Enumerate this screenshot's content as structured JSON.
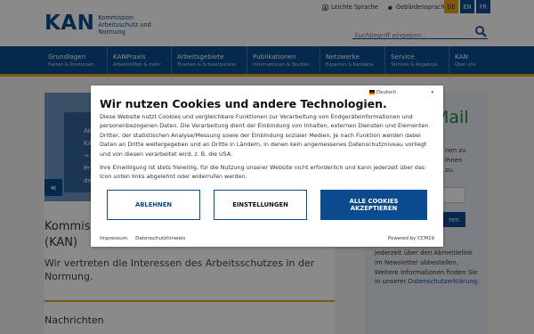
{
  "logo": {
    "mark": "KAN",
    "sub_lines": [
      "Kommission",
      "Arbeitsschutz und",
      "Normung"
    ]
  },
  "toplinks": {
    "easy_language": "Leichte Sprache",
    "sign_language": "Gebärdensprache"
  },
  "languages": [
    {
      "code": "DE",
      "active": true
    },
    {
      "code": "EN",
      "active": false
    },
    {
      "code": "FR",
      "active": false
    }
  ],
  "search": {
    "placeholder": "Suchbegriff eingeben..."
  },
  "nav": [
    {
      "title": "Grundlagen",
      "sub": "Fakten & Positionen"
    },
    {
      "title": "KANPraxis",
      "sub": "Arbeitshilfen & mehr"
    },
    {
      "title": "Arbeitsgebiete",
      "sub": "Themen & Schwerpunkte"
    },
    {
      "title": "Publikationen",
      "sub": "Informationen & Studien"
    },
    {
      "title": "Netzwerke",
      "sub": "Experten & Kontakte"
    },
    {
      "title": "Service",
      "sub": "Termine & Angebote"
    },
    {
      "title": "KAN",
      "sub": "Über uns"
    }
  ],
  "hero": {
    "text_lines": [
      "Ak",
      "KA",
      "→",
      "Pr",
      "de"
    ],
    "prev_arrow": "«"
  },
  "main": {
    "title_line1": "Kommis",
    "title_line2": "(KAN)",
    "subtitle": "Wir vertreten die Interessen des Arbeitsschutzes in der Normung.",
    "news_heading": "Nachrichten"
  },
  "right_col": {
    "mail_heading": "Mail",
    "teaser_lines": [
      "nen zu",
      "ihnen",
      "zu."
    ],
    "button_label": "ren",
    "text": "jederzeit über den Abmeldelink im Newsletter abbestellen. Weitere Informationen finden Sie in unserer",
    "link": "Datenschutzerklärung",
    "link_suffix": "."
  },
  "cookie": {
    "language": "Deutsch",
    "title": "Wir nutzen Cookies und andere Technologien.",
    "para1": "Diese Website nutzt Cookies und vergleichbare Funktionen zur Verarbeitung von Endgeräteinformationen und personenbezogenen Daten. Die Verarbeitung dient der Einbindung von Inhalten, externen Diensten und Elementen Dritter, der statistischen Analyse/Messung sowie der Einbindung sozialer Medien. Je nach Funktion werden dabei Daten an Dritte weitergegeben und an Dritte in Ländern, in denen kein angemessenes Datenschutzniveau vorliegt und von diesen verarbeitet wird, z. B. die USA.",
    "para2": "Ihre Einwilligung ist stets freiwillig, für die Nutzung unserer Website nicht erforderlich und kann jederzeit über das Icon unten links abgelehnt oder widerrufen werden.",
    "btn_reject": "ABLEHNEN",
    "btn_settings": "EINSTELLUNGEN",
    "btn_accept_line1": "ALLE COOKIES",
    "btn_accept_line2": "AKZEPTIEREN",
    "footer_imprint": "Impressum",
    "footer_privacy": "Datenschutzhinweis",
    "powered_by": "Powered by CCM19"
  },
  "colors": {
    "brand_blue": "#0a4a8f",
    "accent_orange": "#e7a31a"
  }
}
